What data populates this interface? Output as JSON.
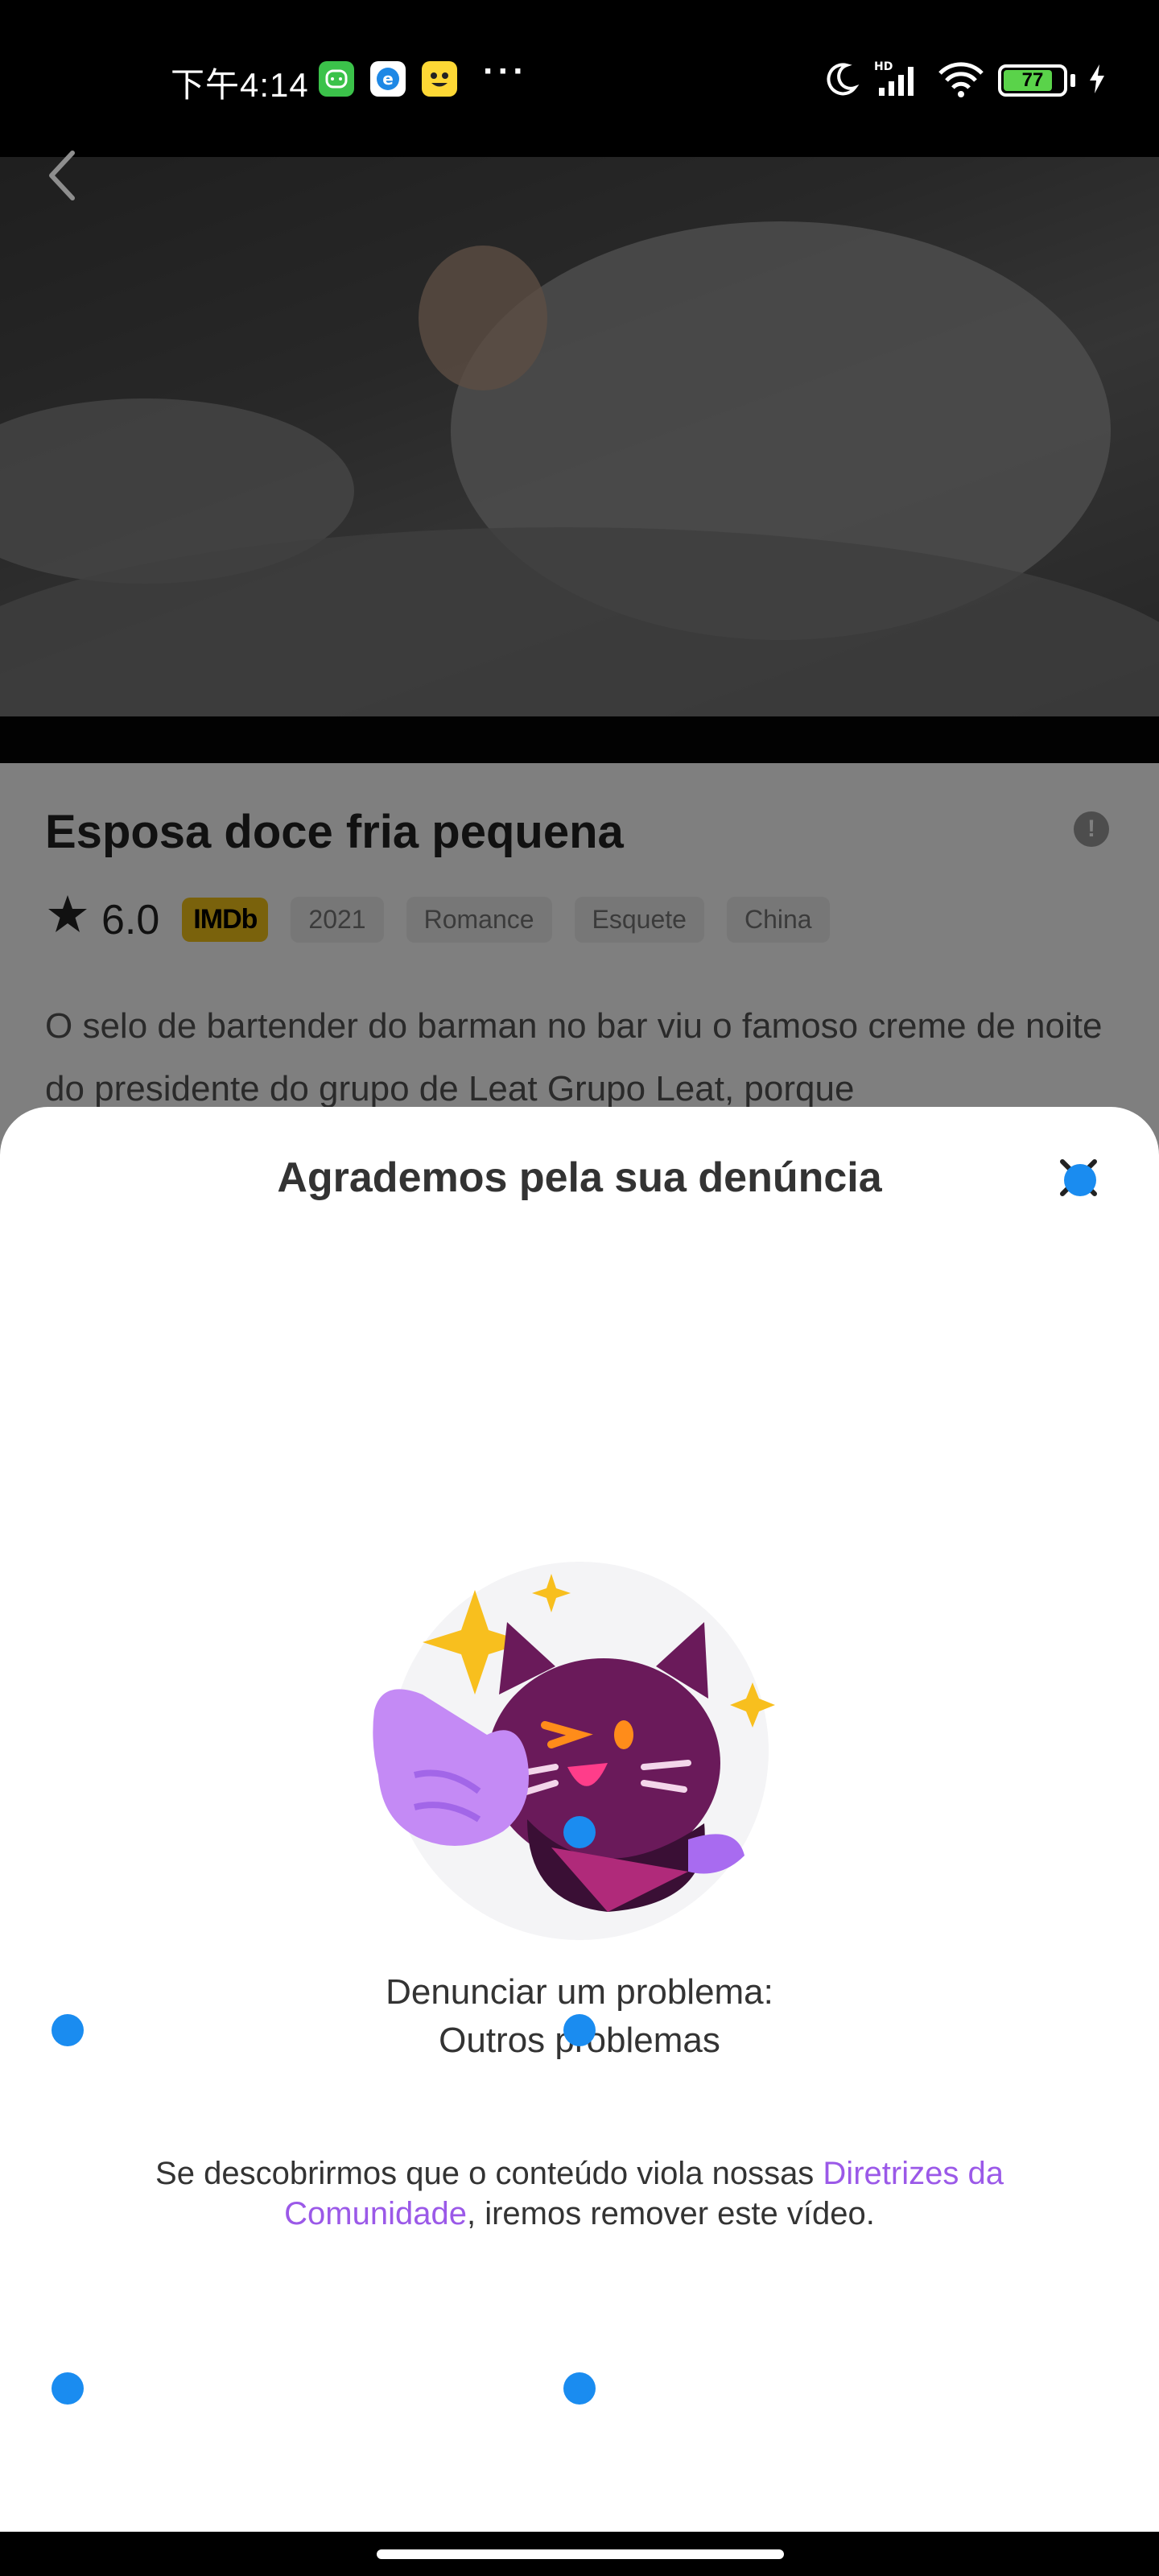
{
  "status_bar": {
    "time": "下午4:14",
    "battery": "77",
    "dots": "···",
    "icons": [
      "wechat-app-icon",
      "browser-app-icon",
      "emoji-app-icon",
      "moon-icon",
      "hd-signal-icon",
      "wifi-icon",
      "battery-icon",
      "charging-icon"
    ]
  },
  "video": {
    "back_icon": "chevron-left-icon"
  },
  "details": {
    "title": "Esposa doce fria pequena",
    "info_icon": "!",
    "rating": "6.0",
    "imdb": "IMDb",
    "tags": [
      "2021",
      "Romance",
      "Esquete",
      "China"
    ],
    "description": "O selo de bartender do barman no bar viu o famoso creme de noite do presidente do grupo de Leat Grupo Leat, porque"
  },
  "sheet": {
    "title": "Agrademos pela sua denúncia",
    "close_icon": "close-icon",
    "illustration": "cat-thumbs-up-illustration",
    "report_line1": "Denunciar um problema:",
    "report_line2": "Outros problemas",
    "notice_before": "Se descobrirmos que o conteúdo viola nossas ",
    "notice_link": "Diretrizes da Comunidade",
    "notice_after": ", iremos remover este vídeo."
  },
  "colors": {
    "accent_link": "#9b59e8",
    "imdb": "#f5c518",
    "marker": "#1a8cf0"
  }
}
